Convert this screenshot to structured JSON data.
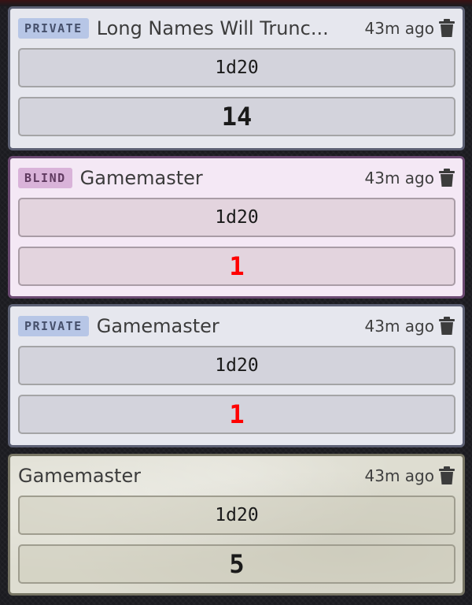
{
  "messages": [
    {
      "badge": "PRIVATE",
      "speaker": "Long Names Will Trunc...",
      "time": "43m ago",
      "formula": "1d20",
      "total": "14"
    },
    {
      "badge": "BLIND",
      "speaker": "Gamemaster",
      "time": "43m ago",
      "formula": "1d20",
      "total": "1"
    },
    {
      "badge": "PRIVATE",
      "speaker": "Gamemaster",
      "time": "43m ago",
      "formula": "1d20",
      "total": "1"
    },
    {
      "speaker": "Gamemaster",
      "time": "43m ago",
      "formula": "1d20",
      "total": "5"
    }
  ],
  "icons": {
    "delete": "trash-icon"
  },
  "colors": {
    "private_badge": "#b7c6e6",
    "blind_badge": "#d9b3d9",
    "failure_total": "#ff0000"
  }
}
